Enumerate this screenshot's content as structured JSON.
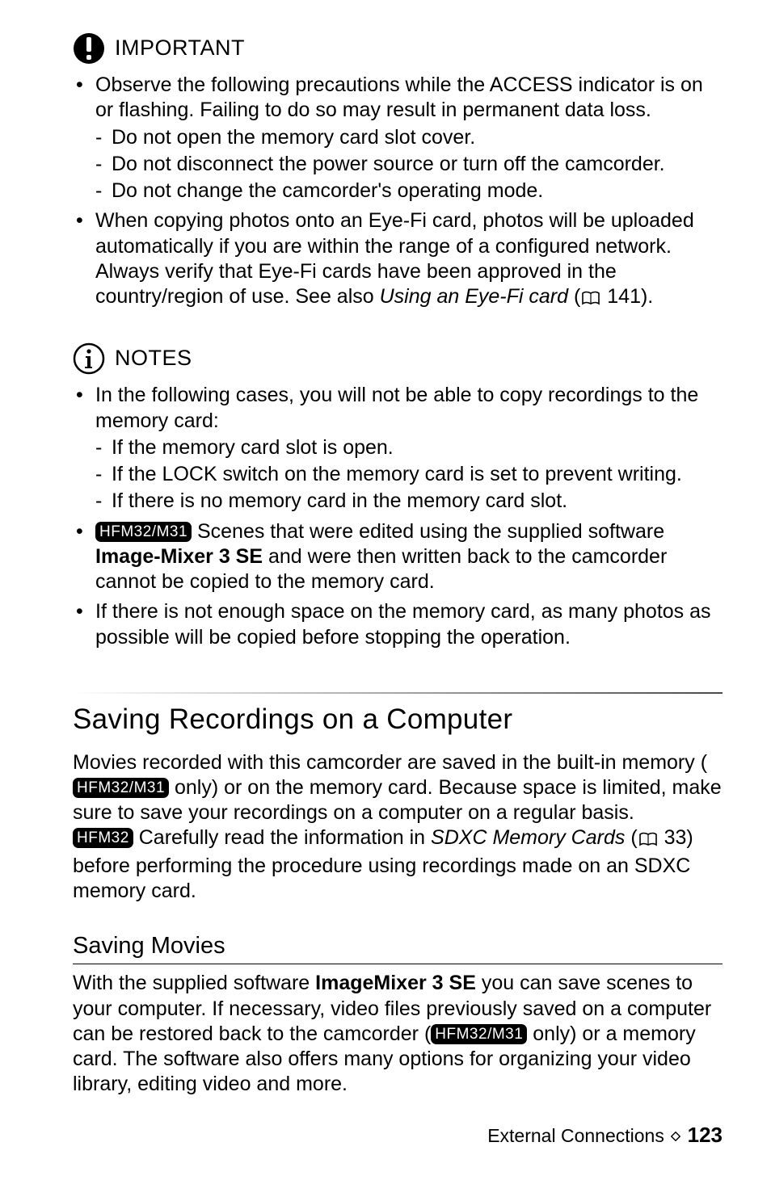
{
  "important": {
    "label": "IMPORTANT",
    "bullets": {
      "b1": {
        "text": "Observe the following precautions while the ACCESS indicator is on or flashing. Failing to do so may result in permanent data loss.",
        "d1": "Do not open the memory card slot cover.",
        "d2": "Do not disconnect the power source or turn off the camcorder.",
        "d3": "Do not change the camcorder's operating mode."
      },
      "b2": {
        "pre": "When copying photos onto an Eye-Fi card, photos will be uploaded automatically if you are within the range of a configured network. Always verify that Eye-Fi cards have been approved in the country/region of use. See also ",
        "em": "Using an Eye-Fi card",
        "open": " (",
        "ref": " 141).",
        "ref_page": "141"
      }
    }
  },
  "notes": {
    "label": "NOTES",
    "bullets": {
      "b1": {
        "text": "In the following cases, you will not be able to copy recordings to the memory card:",
        "d1": "If the memory card slot is open.",
        "d2": "If the LOCK switch on the memory card is set to prevent writing.",
        "d3": "If there is no memory card in the memory card slot."
      },
      "b2": {
        "badge": "HFM32/M31",
        "pre": " Scenes that were edited using the supplied software ",
        "bold": "Image-Mixer 3 SE",
        "post": " and were then written back to the camcorder cannot be copied to the memory card."
      },
      "b3": {
        "text": "If there is not enough space on the memory card, as many photos as possible will be copied before stopping the operation."
      }
    }
  },
  "section": {
    "title": "Saving Recordings on a Computer",
    "body": {
      "s1_pre": "Movies recorded with this camcorder are saved in the built-in memory (",
      "s1_badge": "HFM32/M31",
      "s1_post": " only) or on the memory card. Because space is limited, make sure to save your recordings on a computer on a regular basis.",
      "s2_badge": "HFM32",
      "s2_pre": " Carefully read the information in ",
      "s2_em": "SDXC Memory Cards",
      "s2_open": " (",
      "s2_ref": " 33) before performing the procedure using recordings made on an SDXC memory card.",
      "s2_ref_page": "33"
    }
  },
  "sub": {
    "title": "Saving Movies",
    "body": {
      "pre": "With the supplied software ",
      "bold": "ImageMixer 3 SE",
      "mid": " you can save scenes to your computer. If necessary, video files previously saved on a computer can be restored back to the camcorder (",
      "badge": "HFM32/M31",
      "post": " only) or a memory card. The software also offers many options for organizing your video library, editing video and more."
    }
  },
  "footer": {
    "section": "External Connections",
    "page": "123"
  }
}
